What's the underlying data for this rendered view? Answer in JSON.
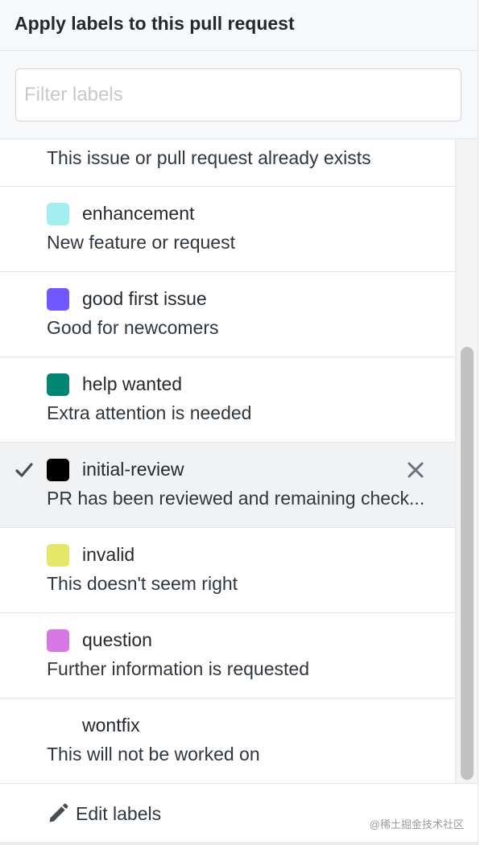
{
  "header": {
    "title": "Apply labels to this pull request"
  },
  "filter": {
    "placeholder": "Filter labels",
    "value": ""
  },
  "labels": [
    {
      "name": "",
      "description": "This issue or pull request already exists",
      "color": "",
      "selected": false
    },
    {
      "name": "enhancement",
      "description": "New feature or request",
      "color": "#a2eeef",
      "selected": false
    },
    {
      "name": "good first issue",
      "description": "Good for newcomers",
      "color": "#7057ff",
      "selected": false
    },
    {
      "name": "help wanted",
      "description": "Extra attention is needed",
      "color": "#008672",
      "selected": false
    },
    {
      "name": "initial-review",
      "description": "PR has been reviewed and remaining check...",
      "color": "#000000",
      "selected": true
    },
    {
      "name": "invalid",
      "description": "This doesn't seem right",
      "color": "#e4e669",
      "selected": false
    },
    {
      "name": "question",
      "description": "Further information is requested",
      "color": "#d876e3",
      "selected": false
    },
    {
      "name": "wontfix",
      "description": "This will not be worked on",
      "color": "#ffffff",
      "selected": false
    }
  ],
  "icons": {
    "check": "check-icon",
    "remove": "close-icon",
    "edit": "pencil-icon"
  },
  "footer": {
    "edit_label": "Edit labels",
    "watermark": "@稀土掘金技术社区"
  }
}
